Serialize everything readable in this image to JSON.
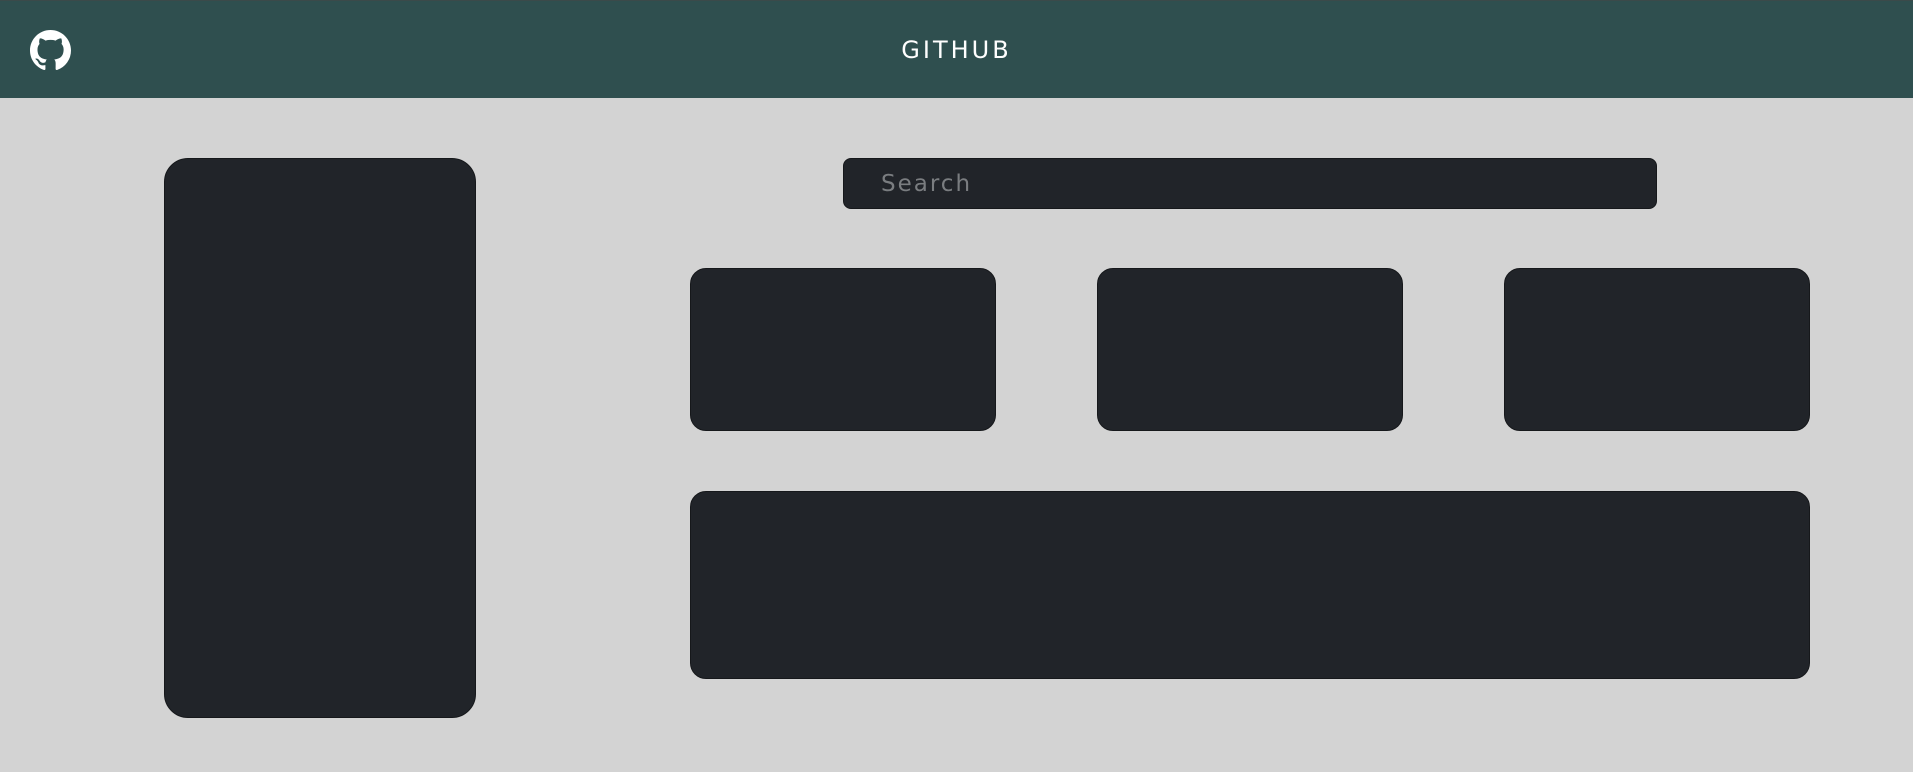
{
  "header": {
    "title": "GITHUB",
    "logo_icon": "github-octocat-icon"
  },
  "search": {
    "placeholder": "Search",
    "value": ""
  },
  "colors": {
    "header_bg": "#2f4f4f",
    "page_bg": "#d3d3d3",
    "card_bg": "#212429",
    "title_text": "#ffffff"
  }
}
